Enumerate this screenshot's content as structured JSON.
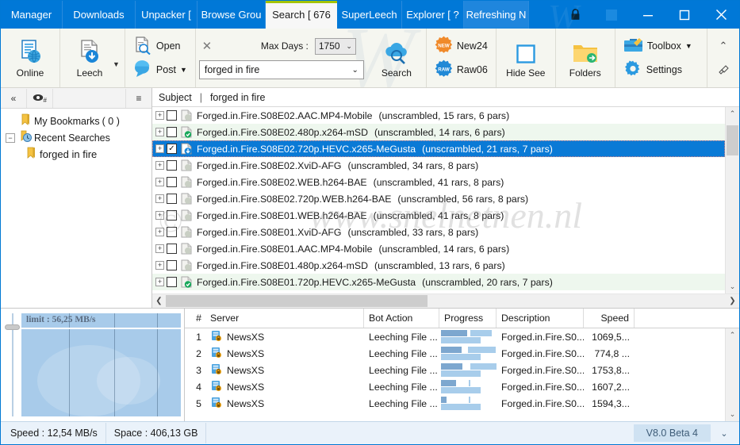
{
  "window": {
    "tabs": [
      {
        "label": "Manager",
        "active": false
      },
      {
        "label": "Downloads",
        "active": false
      },
      {
        "label": "Unpacker [ ",
        "active": false
      },
      {
        "label": "Browse Grou",
        "active": false
      },
      {
        "label": "Search [ 676",
        "active": true
      },
      {
        "label": "SuperLeech",
        "active": false
      },
      {
        "label": "Explorer [ ?",
        "active": false
      },
      {
        "label": "Refreshing N",
        "active": false
      }
    ],
    "controls": {
      "lock": "lock-icon",
      "square": "restore-square-icon",
      "minimize": "–",
      "maximize": "☐",
      "close": "✕"
    },
    "watermark": "W"
  },
  "ribbon": {
    "online": {
      "label": "Online",
      "icon": "online-globe-icon"
    },
    "leech": {
      "label": "Leech",
      "icon": "leech-download-icon",
      "caret": "▼"
    },
    "open": {
      "label": "Open",
      "icon": "open-search-doc-icon"
    },
    "post": {
      "label": "Post",
      "icon": "post-bubble-icon",
      "caret": "▼"
    },
    "clear": {
      "label": "✕",
      "name": "clear-search-button"
    },
    "max_days_label": "Max Days :",
    "max_days_value": "1750",
    "search_value": "forged in fire",
    "search_button": {
      "label": "Search",
      "icon": "search-cloud-icon"
    },
    "new24": {
      "label": "New24",
      "badge": "NEW"
    },
    "raw06": {
      "label": "Raw06",
      "badge": "RAW"
    },
    "hide_seen": {
      "label": "Hide See",
      "icon": "checkbox-empty-icon"
    },
    "folders": {
      "label": "Folders",
      "icon": "folder-arrow-icon"
    },
    "toolbox": {
      "label": "Toolbox",
      "caret": "▼",
      "icon": "toolbox-icon"
    },
    "settings": {
      "label": "Settings",
      "icon": "gear-icon"
    },
    "collapse": "⌃",
    "pin": "pin-icon"
  },
  "sidebar": {
    "toolbar": {
      "collapse": "«",
      "eye": "eye-hash-icon",
      "menu": "≡"
    },
    "tree": [
      {
        "label": "My Bookmarks",
        "count": "( 0 )",
        "level": 1,
        "expander": "",
        "icon": "bookmark-icon"
      },
      {
        "label": "Recent Searches",
        "count": "",
        "level": 1,
        "expander": "−",
        "icon": "recent-searches-icon"
      },
      {
        "label": "forged in fire",
        "count": "",
        "level": 2,
        "expander": "",
        "icon": "bookmark-icon"
      }
    ]
  },
  "list": {
    "header": {
      "subject": "Subject",
      "separator": "|",
      "query": "forged in fire"
    },
    "watermark": "www.snelnetnen.nl",
    "watermark_c": "©",
    "rows": [
      {
        "name": "Forged.in.Fire.S08E02.AAC.MP4-Mobile",
        "meta": "(unscrambled, 15 rars, 6 pars)",
        "checked": false,
        "selected": false,
        "alt": false,
        "icon": "doc-grey-icon"
      },
      {
        "name": "Forged.in.Fire.S08E02.480p.x264-mSD",
        "meta": "(unscrambled, 14 rars, 6 pars)",
        "checked": false,
        "selected": false,
        "alt": true,
        "icon": "doc-green-check-icon"
      },
      {
        "name": "Forged.in.Fire.S08E02.720p.HEVC.x265-MeGusta",
        "meta": "(unscrambled, 21 rars, 7 pars)",
        "checked": true,
        "selected": true,
        "alt": false,
        "icon": "doc-blue-down-icon"
      },
      {
        "name": "Forged.in.Fire.S08E02.XviD-AFG",
        "meta": "(unscrambled, 34 rars, 8 pars)",
        "checked": false,
        "selected": false,
        "alt": false,
        "icon": "doc-grey-icon"
      },
      {
        "name": "Forged.in.Fire.S08E02.WEB.h264-BAE",
        "meta": "(unscrambled, 41 rars, 8 pars)",
        "checked": false,
        "selected": false,
        "alt": false,
        "icon": "doc-grey-icon"
      },
      {
        "name": "Forged.in.Fire.S08E02.720p.WEB.h264-BAE",
        "meta": "(unscrambled, 56 rars, 8 pars)",
        "checked": false,
        "selected": false,
        "alt": false,
        "icon": "doc-grey-icon"
      },
      {
        "name": "Forged.in.Fire.S08E01.WEB.h264-BAE",
        "meta": "(unscrambled, 41 rars, 8 pars)",
        "checked": false,
        "selected": false,
        "alt": false,
        "icon": "doc-grey-icon"
      },
      {
        "name": "Forged.in.Fire.S08E01.XviD-AFG",
        "meta": "(unscrambled, 33 rars, 8 pars)",
        "checked": false,
        "selected": false,
        "alt": false,
        "icon": "doc-grey-icon"
      },
      {
        "name": "Forged.in.Fire.S08E01.AAC.MP4-Mobile",
        "meta": "(unscrambled, 14 rars, 6 pars)",
        "checked": false,
        "selected": false,
        "alt": false,
        "icon": "doc-grey-icon"
      },
      {
        "name": "Forged.in.Fire.S08E01.480p.x264-mSD",
        "meta": "(unscrambled, 13 rars, 6 pars)",
        "checked": false,
        "selected": false,
        "alt": false,
        "icon": "doc-grey-icon"
      },
      {
        "name": "Forged.in.Fire.S08E01.720p.HEVC.x265-MeGusta",
        "meta": "(unscrambled, 20 rars, 7 pars)",
        "checked": false,
        "selected": false,
        "alt": true,
        "icon": "doc-green-check-icon"
      }
    ]
  },
  "gauge": {
    "limit_label": "limit : 56,25 MB/s"
  },
  "table": {
    "columns": [
      "#",
      "Server",
      "Bot Action",
      "Progress",
      "Description",
      "Speed"
    ],
    "rows": [
      {
        "num": "1",
        "server": "NewsXS",
        "bot": "Leeching File ...",
        "desc": "Forged.in.Fire.S0...",
        "speed": "1069,5...",
        "top_dark_pct": 48,
        "top_gap_pct": 6,
        "top_light_pct": 40,
        "bot_light_pct": 74
      },
      {
        "num": "2",
        "server": "NewsXS",
        "bot": "Leeching File ...",
        "desc": "Forged.in.Fire.S0...",
        "speed": "774,8 ...",
        "top_dark_pct": 38,
        "top_gap_pct": 12,
        "top_light_pct": 52,
        "bot_light_pct": 74
      },
      {
        "num": "3",
        "server": "NewsXS",
        "bot": "Leeching File ...",
        "desc": "Forged.in.Fire.S0...",
        "speed": "1753,8...",
        "top_dark_pct": 40,
        "top_gap_pct": 14,
        "top_light_pct": 60,
        "bot_light_pct": 74
      },
      {
        "num": "4",
        "server": "NewsXS",
        "bot": "Leeching File ...",
        "desc": "Forged.in.Fire.S0...",
        "speed": "1607,2...",
        "top_dark_pct": 28,
        "top_gap_pct": 24,
        "top_light_pct": 2,
        "bot_light_pct": 74
      },
      {
        "num": "5",
        "server": "NewsXS",
        "bot": "Leeching File ...",
        "desc": "Forged.in.Fire.S0...",
        "speed": "1594,3...",
        "top_dark_pct": 10,
        "top_gap_pct": 42,
        "top_light_pct": 2,
        "bot_light_pct": 74
      }
    ]
  },
  "status": {
    "speed": "Speed : 12,54 MB/s",
    "space": "Space : 406,13 GB",
    "version": "V8.0 Beta 4",
    "chevron": "⌄"
  }
}
